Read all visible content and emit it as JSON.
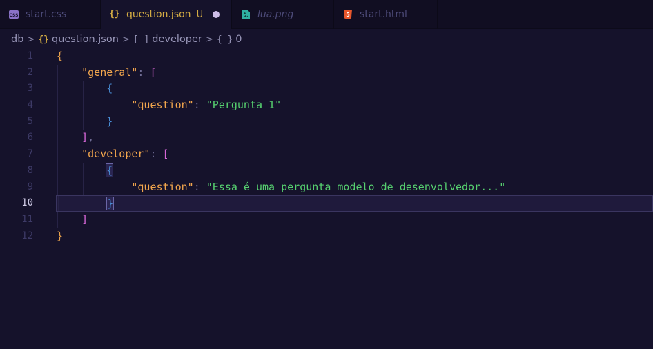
{
  "tabs": [
    {
      "label": "start.css",
      "icon": "css-file-icon",
      "active": false,
      "italic": false
    },
    {
      "label": "question.json",
      "icon": "json-file-icon",
      "active": true,
      "italic": false,
      "status": "U",
      "modified": true
    },
    {
      "label": "lua.png",
      "icon": "image-file-icon",
      "active": false,
      "italic": true
    },
    {
      "label": "start.html",
      "icon": "html-file-icon",
      "active": false,
      "italic": false
    }
  ],
  "breadcrumb": {
    "folder": "db",
    "file": "question.json",
    "array_icon": "[ ]",
    "array": "developer",
    "object_icon": "{ }",
    "object": "0"
  },
  "editor": {
    "current_line": 10,
    "line_numbers": [
      "1",
      "2",
      "3",
      "4",
      "5",
      "6",
      "7",
      "8",
      "9",
      "10",
      "11",
      "12"
    ],
    "lines": {
      "l1_brace": "{",
      "l2_key": "\"general\"",
      "l2_colon": ": ",
      "l2_bracket": "[",
      "l3_brace": "{",
      "l4_key": "\"question\"",
      "l4_colon": ": ",
      "l4_value": "\"Pergunta 1\"",
      "l5_brace": "}",
      "l6_bracket": "]",
      "l6_comma": ",",
      "l7_key": "\"developer\"",
      "l7_colon": ": ",
      "l7_bracket": "[",
      "l8_brace": "{",
      "l9_key": "\"question\"",
      "l9_colon": ": ",
      "l9_value": "\"Essa é uma pergunta modelo de desenvolvedor...\"",
      "l10_brace": "}",
      "l11_bracket": "]",
      "l12_brace": "}"
    }
  },
  "colors": {
    "background": "#15122b",
    "key": "#f2a64d",
    "string": "#56d06f",
    "bracket": "#d466d6",
    "brace": "#e9a24c",
    "inner_brace": "#4a8fd8",
    "tab_active_label": "#d4ac44"
  }
}
